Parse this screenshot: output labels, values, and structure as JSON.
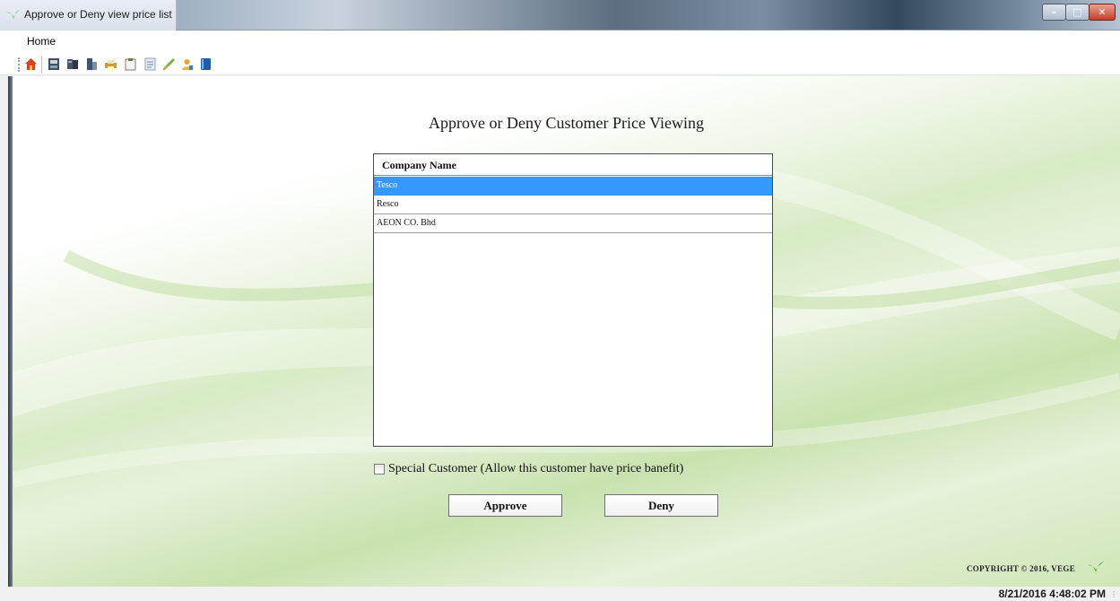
{
  "window": {
    "title": "Approve or Deny view price list",
    "minimize_icon": "minimize-icon",
    "maximize_icon": "maximize-icon",
    "close_icon": "close-icon"
  },
  "menu": {
    "items": [
      "Home"
    ]
  },
  "toolbar": {
    "icons": [
      "home-icon",
      "report-icon",
      "books-icon",
      "book-icon",
      "printer-icon",
      "clipboard-icon",
      "document-icon",
      "brush-icon",
      "users-icon",
      "book-blue-icon"
    ]
  },
  "main": {
    "heading": "Approve or Deny Customer Price Viewing",
    "list": {
      "column_header": "Company Name",
      "rows": [
        "Tesco",
        "Resco",
        "AEON CO. Bhd"
      ],
      "selected_index": 0
    },
    "special_customer": {
      "label": "Special Customer  (Allow this customer have price banefit)",
      "checked": false
    },
    "approve_label": "Approve",
    "deny_label": "Deny",
    "copyright": "COPYRIGHT © 2016, VEGE"
  },
  "status": {
    "datetime": "8/21/2016 4:48:02 PM"
  },
  "colors": {
    "selection": "#3399ff",
    "leaf_green": "#3fae2a"
  }
}
